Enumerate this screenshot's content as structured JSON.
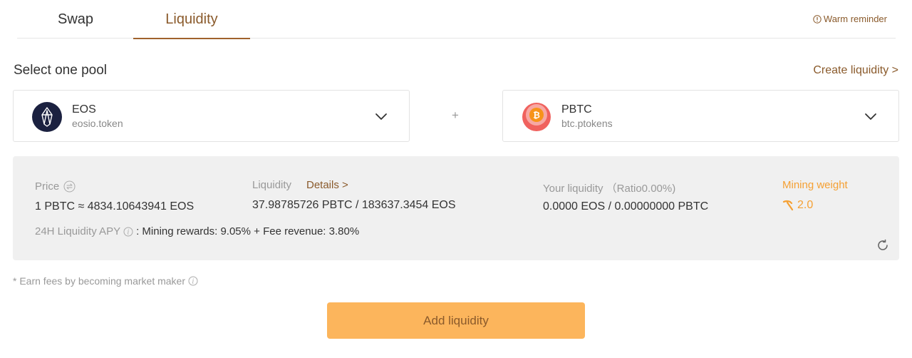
{
  "tabs": [
    {
      "label": "Swap",
      "active": false
    },
    {
      "label": "Liquidity",
      "active": true
    }
  ],
  "warm_reminder": "Warm reminder",
  "pool": {
    "title": "Select one pool",
    "create_link": "Create liquidity >",
    "plus": "+"
  },
  "token_a": {
    "name": "EOS",
    "contract": "eosio.token",
    "icon": "eos-logo-icon"
  },
  "token_b": {
    "name": "PBTC",
    "contract": "btc.ptokens",
    "icon": "pbtc-logo-icon"
  },
  "info": {
    "price_label": "Price",
    "price_value": "1 PBTC ≈ 4834.10643941 EOS",
    "liquidity_label": "Liquidity",
    "details_link": "Details >",
    "liquidity_value": "37.98785726 PBTC / 183637.3454 EOS",
    "your_liquidity_label": "Your liquidity （Ratio0.00%)",
    "your_liquidity_value": "0.0000 EOS / 0.00000000 PBTC",
    "mining_weight_label": "Mining weight",
    "mining_weight_value": "2.0",
    "apy_label": "24H Liquidity APY",
    "apy_value": ": Mining rewards: 9.05% + Fee revenue: 3.80%"
  },
  "note": "* Earn fees by becoming market maker",
  "add_button": "Add liquidity",
  "colors": {
    "accent": "#8a5a2b",
    "orange": "#f5a033",
    "button": "#fcb55c",
    "panel": "#f0f0f0"
  }
}
